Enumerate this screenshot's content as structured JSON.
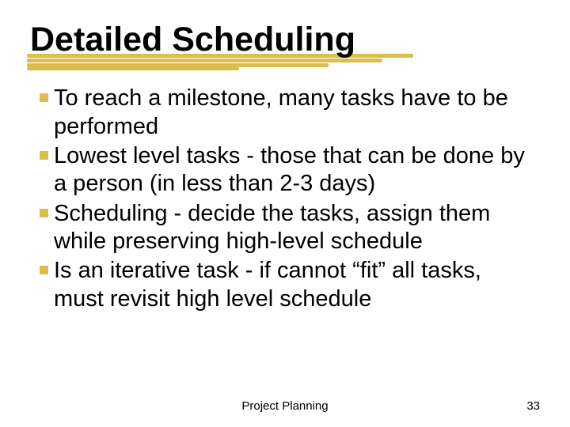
{
  "title": "Detailed Scheduling",
  "bullets": [
    "To reach a milestone, many tasks have to be performed",
    "Lowest level tasks - those that can be done by a person (in less than 2-3 days)",
    "Scheduling - decide the tasks, assign them while preserving high-level schedule",
    "Is an iterative task - if cannot “fit” all tasks, must revisit high level schedule"
  ],
  "footer": {
    "label": "Project Planning"
  },
  "page_number": "33",
  "colors": {
    "accent": "#dcbf4a",
    "text": "#000000",
    "background": "#ffffff"
  }
}
